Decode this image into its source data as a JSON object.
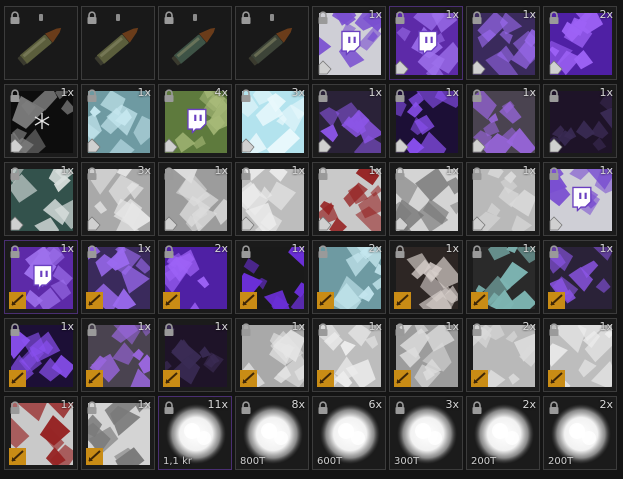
{
  "inventory": {
    "rows": [
      [
        {
          "name": "cartridge-icon",
          "kind": "ammo",
          "qty": "",
          "tint": "#5b5e3c"
        },
        {
          "name": "cartridge-icon",
          "kind": "ammo",
          "qty": "",
          "tint": "#5b5e3c"
        },
        {
          "name": "cartridge-icon",
          "kind": "ammo",
          "qty": "",
          "tint": "#3e5346"
        },
        {
          "name": "cartridge-icon",
          "kind": "ammo",
          "qty": "",
          "tint": "#3d4438"
        },
        {
          "name": "twitch-logo-pattern-icon",
          "kind": "camo",
          "qty": "1x",
          "fill": "#cfcfd6",
          "pattern": "#7a4fd0",
          "icon": "twitch",
          "lock": true,
          "corner": true
        },
        {
          "name": "twitch-logo-stripes-icon",
          "kind": "camo",
          "qty": "1x",
          "fill": "#5d2aa8",
          "pattern": "#9d70ec",
          "icon": "twitch",
          "lock": true,
          "corner": true,
          "rare": true
        },
        {
          "name": "purple-hex-camo-icon",
          "kind": "camo",
          "qty": "1x",
          "fill": "#3a2a5c",
          "pattern": "#9b6af0",
          "lock": true,
          "corner": true
        },
        {
          "name": "purple-zigzag-camo-icon",
          "kind": "camo",
          "qty": "2x",
          "fill": "#4f20a4",
          "pattern": "#9d62f6",
          "lock": true,
          "corner": true
        }
      ],
      [
        {
          "name": "snowflake-dark-camo-icon",
          "kind": "camo",
          "qty": "1x",
          "fill": "#0d0d0d",
          "pattern": "#7e7e7e",
          "icon": "snow",
          "lock": true,
          "corner": true
        },
        {
          "name": "cyan-splatter-camo-icon",
          "kind": "camo",
          "qty": "1x",
          "fill": "#6e9aa2",
          "pattern": "#c4e6ee",
          "lock": true,
          "corner": true
        },
        {
          "name": "twitch-green-camo-icon",
          "kind": "camo",
          "qty": "4x",
          "fill": "#5e7a3d",
          "pattern": "#a7b978",
          "icon": "twitch",
          "lock": true,
          "corner": true
        },
        {
          "name": "light-blue-ice-camo-icon",
          "kind": "camo",
          "qty": "3x",
          "fill": "#b3e3ee",
          "pattern": "#e8f8fc",
          "lock": true,
          "corner": true
        },
        {
          "name": "purple-tiger-camo-icon",
          "kind": "camo",
          "qty": "1x",
          "fill": "#2a2238",
          "pattern": "#8b55e6",
          "lock": true,
          "corner": true
        },
        {
          "name": "purple-lava-camo-icon",
          "kind": "camo",
          "qty": "1x",
          "fill": "#1c0f36",
          "pattern": "#8a50f0",
          "lock": true,
          "corner": true
        },
        {
          "name": "purple-urban-camo-icon",
          "kind": "camo",
          "qty": "1x",
          "fill": "#4a4350",
          "pattern": "#9966dd",
          "lock": true,
          "corner": true
        },
        {
          "name": "dark-purple-camo-icon",
          "kind": "camo",
          "qty": "1x",
          "fill": "#1e1328",
          "pattern": "#3a2b54",
          "lock": true,
          "corner": true
        }
      ],
      [
        {
          "name": "green-snow-camo-icon",
          "kind": "camo",
          "qty": "1x",
          "fill": "#33524c",
          "pattern": "#d9dfdd",
          "lock": true,
          "corner": true
        },
        {
          "name": "white-snow-camo-icon",
          "kind": "camo",
          "qty": "3x",
          "fill": "#a9a9a9",
          "pattern": "#e6e6e6",
          "lock": true,
          "corner": true
        },
        {
          "name": "grey-arctic-camo-icon",
          "kind": "camo",
          "qty": "1x",
          "fill": "#9c9c9c",
          "pattern": "#dcdcdc",
          "lock": true,
          "corner": true
        },
        {
          "name": "white-arctic-camo-icon",
          "kind": "camo",
          "qty": "1x",
          "fill": "#bdbdbd",
          "pattern": "#ececec",
          "lock": true,
          "corner": true
        },
        {
          "name": "red-arctic-camo-icon",
          "kind": "camo",
          "qty": "1x",
          "fill": "#c9c9c9",
          "pattern": "#962424",
          "lock": true,
          "corner": true
        },
        {
          "name": "white-bird-camo-icon",
          "kind": "camo",
          "qty": "1x",
          "fill": "#d4d4d4",
          "pattern": "#7a7a7a",
          "lock": true,
          "corner": true
        },
        {
          "name": "light-grey-camo-icon",
          "kind": "camo",
          "qty": "1x",
          "fill": "#b9b9b9",
          "pattern": "#dadada",
          "lock": true,
          "corner": true
        },
        {
          "name": "twitch-logo-pattern-icon",
          "kind": "camo",
          "qty": "1x",
          "fill": "#cfcfd6",
          "pattern": "#7a4fd0",
          "icon": "twitch",
          "lock": true,
          "corner": true
        }
      ],
      [
        {
          "name": "twitch-logo-stripes-icon",
          "kind": "camo",
          "qty": "1x",
          "fill": "#5d2aa8",
          "pattern": "#9d70ec",
          "icon": "twitch",
          "lock": true,
          "badge": true,
          "rare": true
        },
        {
          "name": "purple-hex-camo-icon",
          "kind": "camo",
          "qty": "1x",
          "fill": "#3a2a5c",
          "pattern": "#9b6af0",
          "lock": true,
          "badge": true
        },
        {
          "name": "purple-zigzag-camo-icon",
          "kind": "camo",
          "qty": "2x",
          "fill": "#4f20a4",
          "pattern": "#9d62f6",
          "lock": true,
          "badge": true
        },
        {
          "name": "purple-hexagon-grid-camo-icon",
          "kind": "camo",
          "qty": "1x",
          "fill": "#1a1a1a",
          "pattern": "#6a2fd6",
          "lock": true,
          "badge": true
        },
        {
          "name": "cyan-splatter-camo-icon",
          "kind": "camo",
          "qty": "2x",
          "fill": "#6e9aa2",
          "pattern": "#c4e6ee",
          "lock": true,
          "badge": true
        },
        {
          "name": "glyph-pattern-camo-icon",
          "kind": "camo",
          "qty": "1x",
          "fill": "#2d2624",
          "pattern": "#d8d0cc",
          "lock": true,
          "badge": true
        },
        {
          "name": "teal-geometric-camo-icon",
          "kind": "camo",
          "qty": "1x",
          "fill": "#2a2a2a",
          "pattern": "#7db5b2",
          "lock": true,
          "badge": true
        },
        {
          "name": "purple-tiger-camo-icon",
          "kind": "camo",
          "qty": "1x",
          "fill": "#2a2238",
          "pattern": "#8b55e6",
          "lock": true,
          "badge": true
        }
      ],
      [
        {
          "name": "purple-lava-camo-icon",
          "kind": "camo",
          "qty": "1x",
          "fill": "#1c0f36",
          "pattern": "#8a50f0",
          "lock": true,
          "badge": true
        },
        {
          "name": "purple-urban-camo-icon",
          "kind": "camo",
          "qty": "1x",
          "fill": "#4a4350",
          "pattern": "#9966dd",
          "lock": true,
          "badge": true
        },
        {
          "name": "dark-purple-camo-icon",
          "kind": "camo",
          "qty": "1x",
          "fill": "#1e1328",
          "pattern": "#3a2b54",
          "lock": true,
          "badge": true
        },
        {
          "name": "white-snow-camo-icon",
          "kind": "camo",
          "qty": "1x",
          "fill": "#a9a9a9",
          "pattern": "#e6e6e6",
          "lock": true,
          "badge": true
        },
        {
          "name": "white-arctic-camo-icon",
          "kind": "camo",
          "qty": "1x",
          "fill": "#bdbdbd",
          "pattern": "#ececec",
          "lock": true,
          "badge": true
        },
        {
          "name": "grey-arctic-camo-icon",
          "kind": "camo",
          "qty": "1x",
          "fill": "#9c9c9c",
          "pattern": "#dcdcdc",
          "lock": true,
          "badge": true
        },
        {
          "name": "light-grey-camo-icon",
          "kind": "camo",
          "qty": "2x",
          "fill": "#b9b9b9",
          "pattern": "#dadada",
          "lock": true,
          "badge": true
        },
        {
          "name": "white-arctic-camo-icon",
          "kind": "camo",
          "qty": "1x",
          "fill": "#bdbdbd",
          "pattern": "#ececec",
          "lock": true,
          "badge": true
        }
      ],
      [
        {
          "name": "red-arctic-camo-icon",
          "kind": "camo",
          "qty": "1x",
          "fill": "#c9c9c9",
          "pattern": "#962424",
          "lock": true,
          "badge": true
        },
        {
          "name": "white-bird-camo-icon",
          "kind": "camo",
          "qty": "1x",
          "fill": "#d4d4d4",
          "pattern": "#7a7a7a",
          "lock": true,
          "badge": true
        },
        {
          "name": "glowing-orb-icon",
          "kind": "orb",
          "qty": "11x",
          "value": "1,1 kr",
          "lock": true,
          "rare": true
        },
        {
          "name": "glowing-orb-icon",
          "kind": "orb",
          "qty": "8x",
          "value": "800T",
          "lock": true
        },
        {
          "name": "glowing-orb-icon",
          "kind": "orb",
          "qty": "6x",
          "value": "600T",
          "lock": true
        },
        {
          "name": "glowing-orb-icon",
          "kind": "orb",
          "qty": "3x",
          "value": "300T",
          "lock": true
        },
        {
          "name": "glowing-orb-icon",
          "kind": "orb",
          "qty": "2x",
          "value": "200T",
          "lock": true
        },
        {
          "name": "glowing-orb-icon",
          "kind": "orb",
          "qty": "2x",
          "value": "200T",
          "lock": true
        }
      ]
    ]
  }
}
